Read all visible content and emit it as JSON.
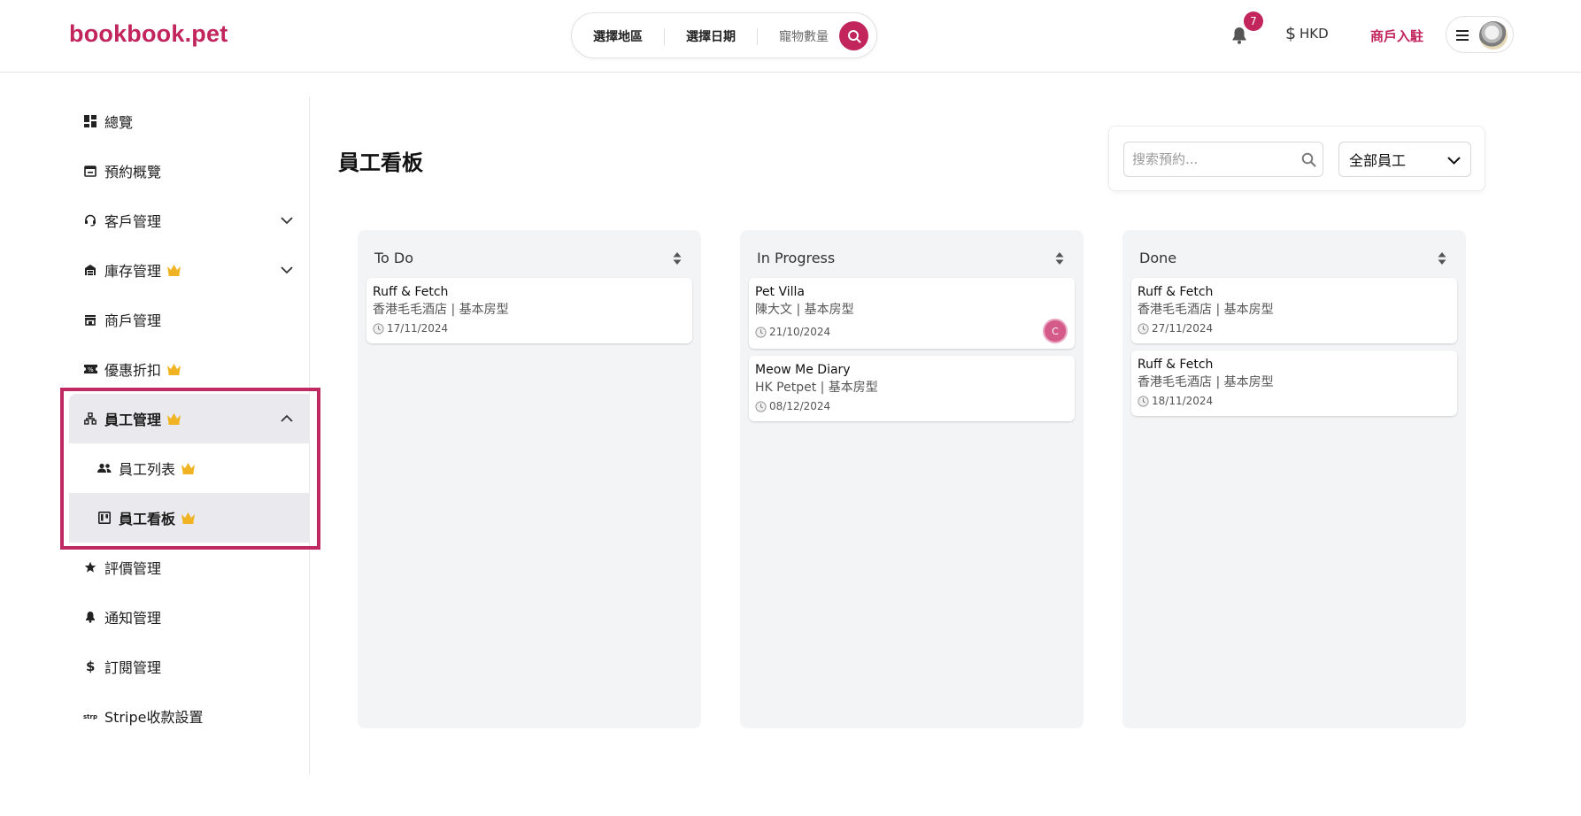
{
  "header": {
    "logo": "bookbook.pet",
    "search": {
      "region": "選擇地區",
      "date": "選擇日期",
      "pets": "寵物數量"
    },
    "notification_count": "7",
    "currency": "HKD",
    "merchant_link": "商戶入駐"
  },
  "sidebar": {
    "items": [
      {
        "label": "總覽"
      },
      {
        "label": "預約概覽"
      },
      {
        "label": "客戶管理"
      },
      {
        "label": "庫存管理"
      },
      {
        "label": "商戶管理"
      },
      {
        "label": "優惠折扣"
      },
      {
        "label": "員工管理"
      },
      {
        "label": "員工列表"
      },
      {
        "label": "員工看板"
      },
      {
        "label": "評價管理"
      },
      {
        "label": "通知管理"
      },
      {
        "label": "訂閱管理"
      },
      {
        "label": "Stripe收款設置"
      }
    ]
  },
  "main": {
    "title": "員工看板",
    "search_placeholder": "搜索預約...",
    "staff_filter": "全部員工"
  },
  "board": {
    "columns": [
      {
        "title": "To Do",
        "cards": [
          {
            "title": "Ruff & Fetch",
            "sub": "香港毛毛酒店 | 基本房型",
            "date": "17/11/2024"
          }
        ]
      },
      {
        "title": "In Progress",
        "cards": [
          {
            "title": "Pet Villa",
            "sub": "陳大文 | 基本房型",
            "date": "21/10/2024",
            "assignee": "C"
          },
          {
            "title": "Meow Me Diary",
            "sub": "HK Petpet | 基本房型",
            "date": "08/12/2024"
          }
        ]
      },
      {
        "title": "Done",
        "cards": [
          {
            "title": "Ruff & Fetch",
            "sub": "香港毛毛酒店 | 基本房型",
            "date": "27/11/2024"
          },
          {
            "title": "Ruff & Fetch",
            "sub": "香港毛毛酒店 | 基本房型",
            "date": "18/11/2024"
          }
        ]
      }
    ]
  },
  "colors": {
    "brand": "#c2255c",
    "crown": "#f0b323",
    "column_bg": "#f3f4f6",
    "highlight": "#bf2a63"
  }
}
